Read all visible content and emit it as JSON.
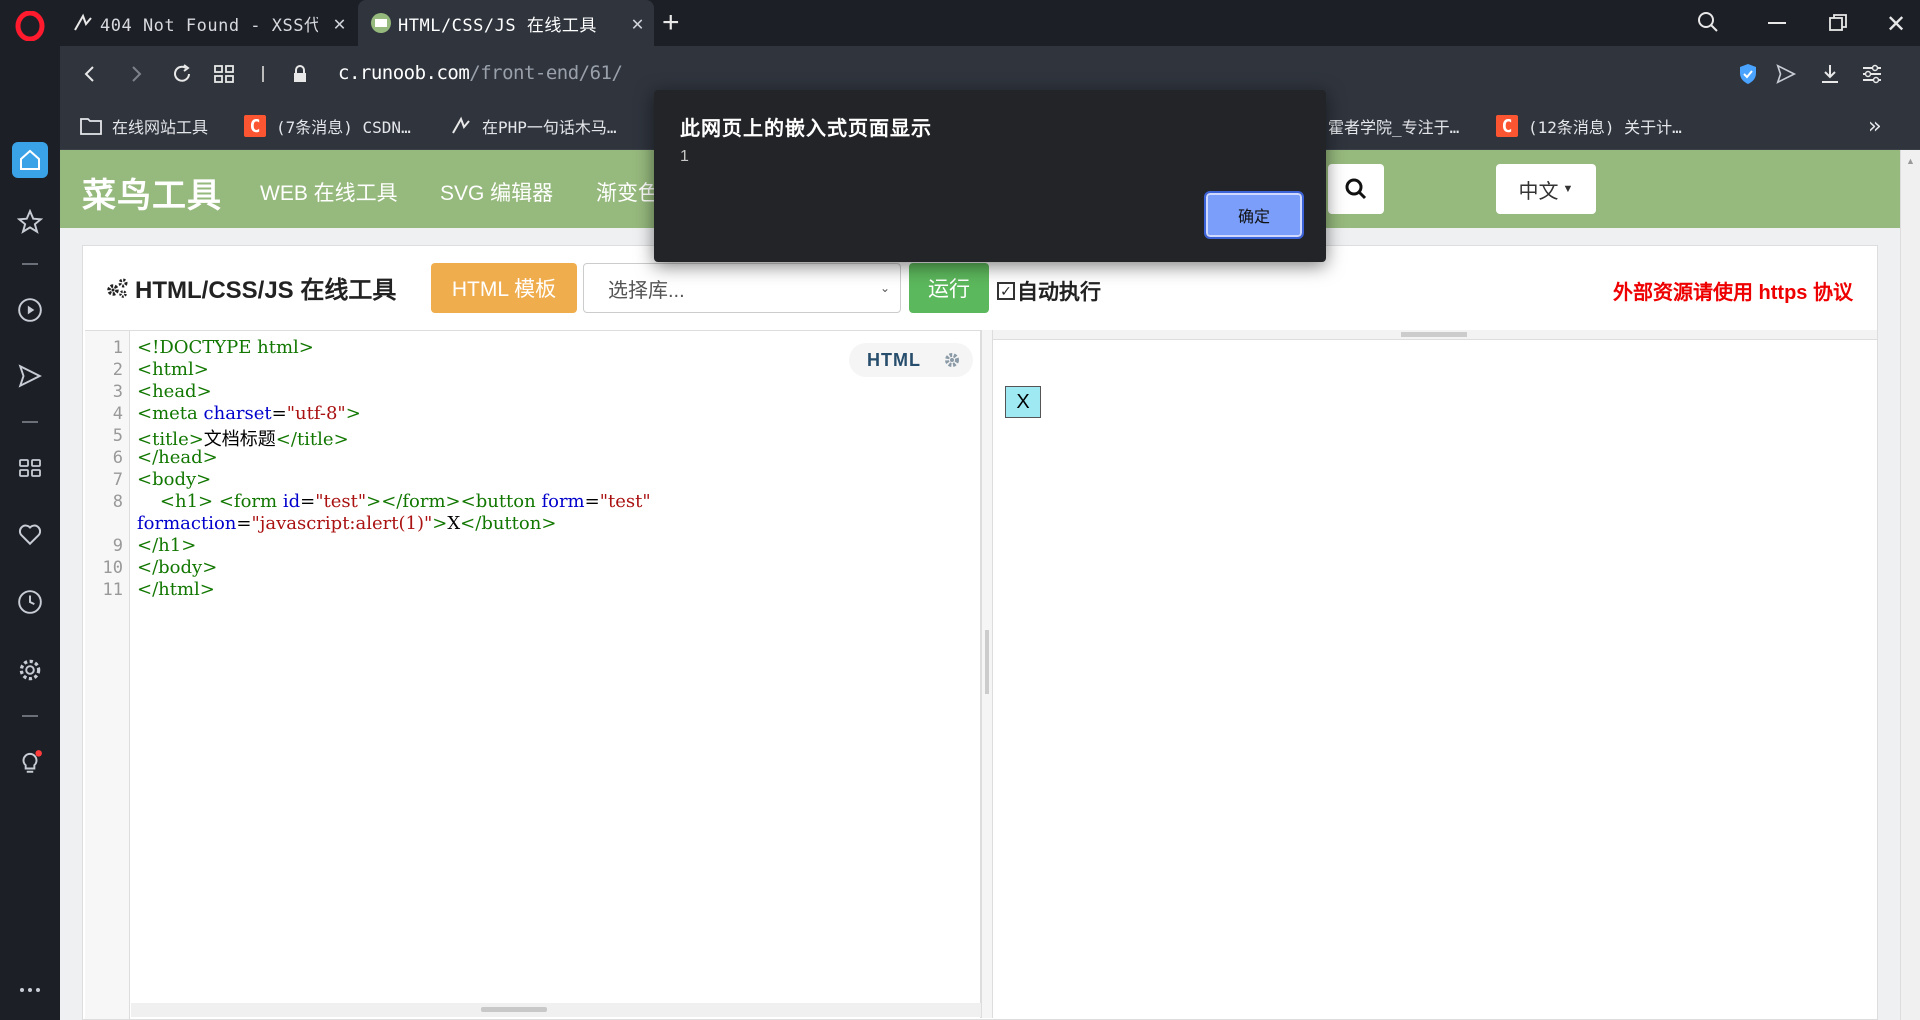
{
  "browser": {
    "tabs": [
      {
        "title": "404 Not Found - XSS代",
        "active": false
      },
      {
        "title": "HTML/CSS/JS 在线工具",
        "active": true
      }
    ],
    "new_tab": "+",
    "url_host": "c.runoob.com",
    "url_path": "/front-end/61/",
    "bookmarks": [
      {
        "label": "在线网站工具",
        "icon": "folder-icon"
      },
      {
        "label": "(7条消息) CSDN…",
        "icon": "csdn-icon"
      },
      {
        "label": "在PHP一句话木马…",
        "icon": "bookmark-icon"
      },
      {
        "label": "霍者学院_专注于…",
        "icon": "bookmark-icon"
      },
      {
        "label": "(12条消息) 关于计…",
        "icon": "csdn-icon"
      }
    ],
    "csdn_glyph": "C",
    "more_bookmarks": "»"
  },
  "site": {
    "logo": "菜鸟工具",
    "nav": [
      "WEB 在线工具",
      "SVG 编辑器",
      "渐变色"
    ],
    "lang": "中文"
  },
  "tool": {
    "title": "HTML/CSS/JS 在线工具",
    "template_button": "HTML 模板",
    "library_select": "选择库...",
    "run_button": "运行",
    "auto_run_label": "自动执行",
    "auto_run_checked": "✓",
    "https_note": "外部资源请使用 https 协议",
    "editor_mode": "HTML"
  },
  "editor": {
    "line_numbers": [
      "1",
      "2",
      "3",
      "4",
      "5",
      "6",
      "7",
      "8",
      "9",
      "10",
      "11"
    ]
  },
  "preview": {
    "button_label": "X"
  },
  "dialog": {
    "title": "此网页上的嵌入式页面显示",
    "message": "1",
    "ok_label": "确定"
  },
  "colors": {
    "site_header": "#96b97d",
    "template_button": "#f0ad4e",
    "run_button": "#5cb85c",
    "https_note": "#ee0000",
    "dialog_bg": "#232428",
    "dialog_ok": "#7a9ef9"
  }
}
